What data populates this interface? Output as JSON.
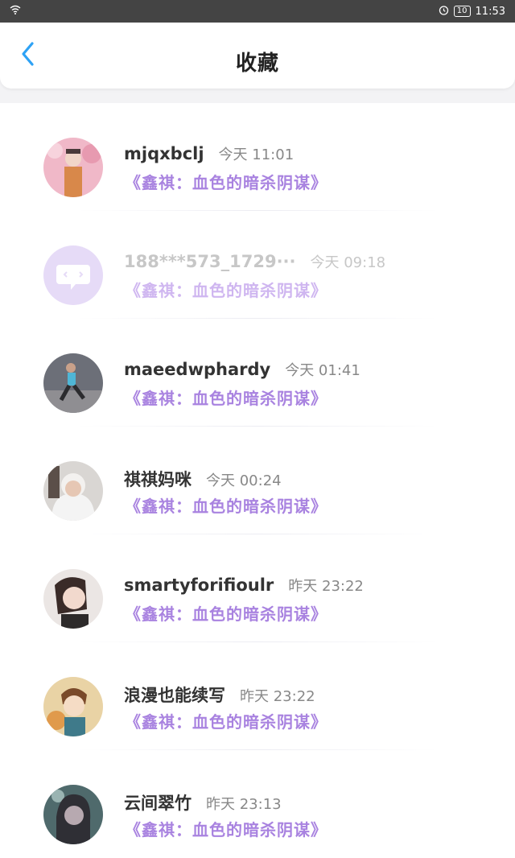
{
  "status_bar": {
    "time": "11:53",
    "battery": "10",
    "icons": [
      "wifi-icon",
      "alarm-icon",
      "battery-icon"
    ]
  },
  "header": {
    "title": "收藏",
    "back_icon": "chevron-left-icon"
  },
  "colors": {
    "accent_back": "#2ea2f5",
    "book_title": "#a983e0",
    "faded_book_title": "#cfb6f0"
  },
  "favorites": [
    {
      "name": "mjqxbclj",
      "time": "今天 11:01",
      "book": "《鑫祺：血色的暗杀阴谋》",
      "avatar": "avatar-photo"
    },
    {
      "name": "188***573_1729···",
      "time": "今天 09:18",
      "book": "《鑫祺：血色的暗杀阴谋》",
      "avatar": "default-avatar-icon"
    },
    {
      "name": "maeedwphardy",
      "time": "今天 01:41",
      "book": "《鑫祺：血色的暗杀阴谋》",
      "avatar": "avatar-photo"
    },
    {
      "name": "祺祺妈咪",
      "time": "今天 00:24",
      "book": "《鑫祺：血色的暗杀阴谋》",
      "avatar": "avatar-photo"
    },
    {
      "name": "smartyforifioulr",
      "time": "昨天 23:22",
      "book": "《鑫祺：血色的暗杀阴谋》",
      "avatar": "avatar-photo"
    },
    {
      "name": "浪漫也能续写",
      "time": "昨天 23:22",
      "book": "《鑫祺：血色的暗杀阴谋》",
      "avatar": "avatar-photo"
    },
    {
      "name": "云间翠竹",
      "time": "昨天 23:13",
      "book": "《鑫祺：血色的暗杀阴谋》",
      "avatar": "avatar-photo"
    }
  ]
}
